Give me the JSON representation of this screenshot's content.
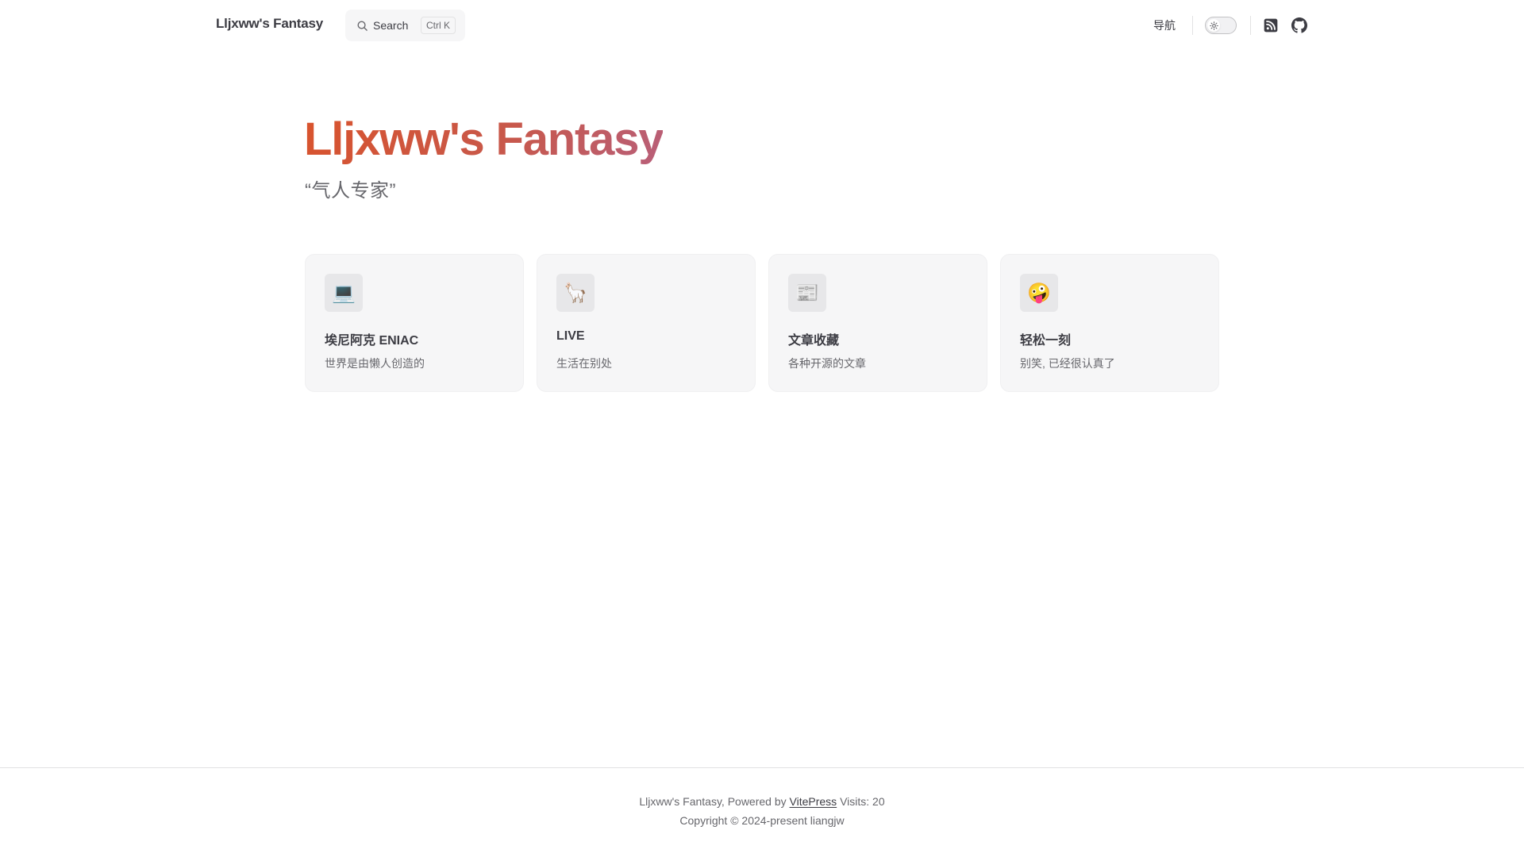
{
  "nav": {
    "site_title": "Lljxww's Fantasy",
    "search": {
      "label": "Search",
      "shortcut": "Ctrl K"
    },
    "link_nav": "导航",
    "theme_toggle": "light",
    "social": [
      "rss-icon",
      "github-icon"
    ]
  },
  "hero": {
    "name": "Lljxww's Fantasy",
    "tagline": "“气人专家”"
  },
  "features": [
    {
      "icon": "💻",
      "icon_name": "laptop-icon",
      "title": "埃尼阿克 ENIAC",
      "details": "世界是由懒人创造的"
    },
    {
      "icon": "🦙",
      "icon_name": "llama-icon",
      "title": "LIVE",
      "details": "生活在别处"
    },
    {
      "icon": "📰",
      "icon_name": "newspaper-icon",
      "title": "文章收藏",
      "details": "各种开源的文章"
    },
    {
      "icon": "🤪",
      "icon_name": "zany-face-icon",
      "title": "轻松一刻",
      "details": "别笑, 已经很认真了"
    }
  ],
  "footer": {
    "line1_prefix": "Lljxww's Fantasy, Powered by ",
    "line1_link": "VitePress",
    "line1_suffix": " Visits: 20",
    "line2": "Copyright © 2024-present liangjw"
  },
  "colors": {
    "brand_gradient_start": "#d9532c",
    "brand_gradient_end": "#b85f7a",
    "card_bg": "#f6f6f7"
  }
}
